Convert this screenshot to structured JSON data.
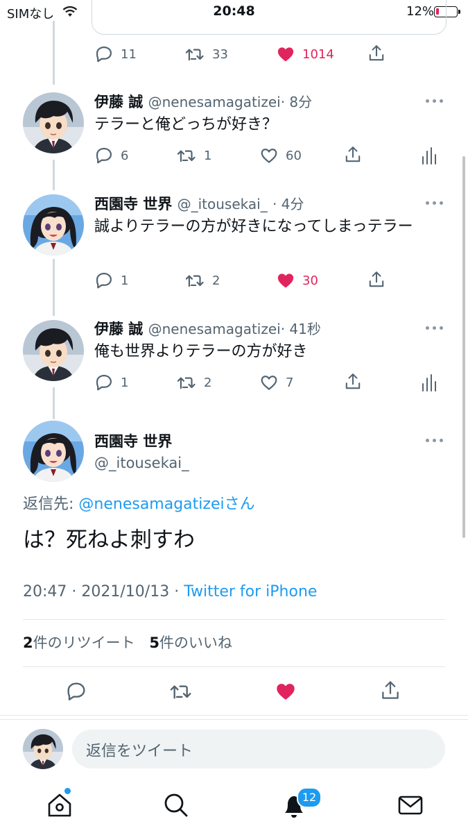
{
  "status_bar": {
    "carrier": "SIMなし",
    "time": "20:48",
    "battery": "12%"
  },
  "prev_tweet": {
    "replies": "11",
    "retweets": "33",
    "likes": "1014",
    "liked": true
  },
  "thread": [
    {
      "name": "伊藤 誠",
      "handle": "@nenesamagatizei",
      "time": "· 8分",
      "text": "テラーと俺どっちが好き？",
      "replies": "6",
      "retweets": "1",
      "likes": "60",
      "liked": false,
      "avatar": "makoto"
    },
    {
      "name": "西園寺 世界",
      "handle": "@_itousekai_",
      "time": "· 4分",
      "text": "誠よりテラーの方が好きになってしまっテラー",
      "replies": "1",
      "retweets": "2",
      "likes": "30",
      "liked": true,
      "avatar": "sekai"
    },
    {
      "name": "伊藤 誠",
      "handle": "@nenesamagatizei",
      "time": "· 41秒",
      "text": "俺も世界よりテラーの方が好き",
      "replies": "1",
      "retweets": "2",
      "likes": "7",
      "liked": false,
      "avatar": "makoto"
    }
  ],
  "main_tweet": {
    "name": "西園寺 世界",
    "handle": "@_itousekai_",
    "reply_to_label": "返信先: ",
    "reply_to_handle": "@nenesamagatizeiさん",
    "text": "は？死ねよ刺すわ",
    "time": "20:47",
    "date": "2021/10/13",
    "source": "Twitter for iPhone",
    "retweet_count": "2",
    "retweet_label": "件のリツイート",
    "like_count": "5",
    "like_label": "件のいいね"
  },
  "reply_composer": {
    "placeholder": "返信をツイート"
  },
  "tabbar": {
    "notifications_badge": "12"
  },
  "colors": {
    "like": "#e0245e",
    "link": "#1d9bf0",
    "muted": "#536471"
  }
}
